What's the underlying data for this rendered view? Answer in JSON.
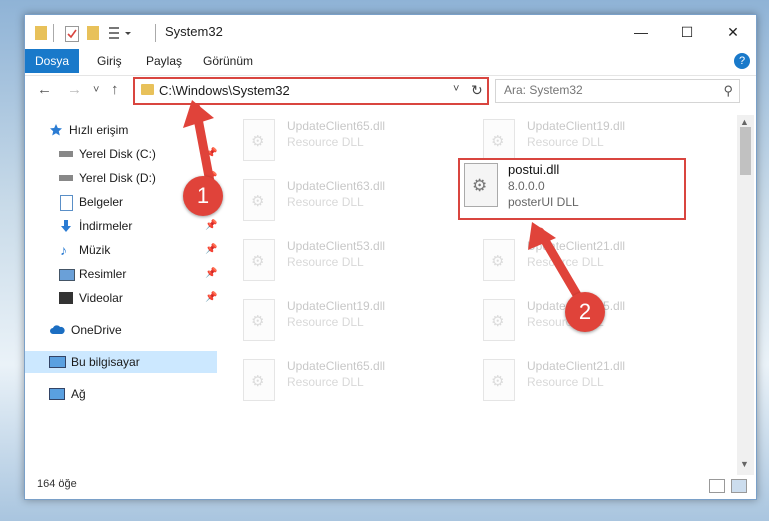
{
  "window": {
    "title": "System32",
    "minimize_glyph": "—",
    "maximize_glyph": "☐",
    "close_glyph": "✕"
  },
  "ribbon": {
    "tabs": [
      {
        "label": "Dosya"
      },
      {
        "label": "Giriş"
      },
      {
        "label": "Paylaş"
      },
      {
        "label": "Görünüm"
      }
    ],
    "help_glyph": "?"
  },
  "nav": {
    "back_glyph": "←",
    "forward_glyph": "→",
    "recent_glyph": "˅",
    "up_glyph": "↑"
  },
  "address": {
    "path": "C:\\Windows\\System32",
    "dropdown_glyph": "˅",
    "refresh_glyph": "↻"
  },
  "search": {
    "placeholder": "Ara: System32",
    "icon_glyph": "⚲"
  },
  "sidebar": {
    "items": [
      {
        "label": "Hızlı erişim"
      },
      {
        "label": "Yerel Disk (C:)"
      },
      {
        "label": "Yerel Disk (D:)"
      },
      {
        "label": "Belgeler"
      },
      {
        "label": "İndirmeler"
      },
      {
        "label": "Müzik"
      },
      {
        "label": "Resimler"
      },
      {
        "label": "Videolar"
      },
      {
        "label": "OneDrive"
      },
      {
        "label": "Bu bilgisayar"
      },
      {
        "label": "Ağ"
      }
    ]
  },
  "files": [
    {
      "name": "UpdateClient65.dll",
      "desc": "Resource DLL"
    },
    {
      "name": "UpdateClient19.dll",
      "desc": "Resource DLL"
    },
    {
      "name": "UpdateClient63.dll",
      "desc": "Resource DLL"
    },
    {
      "name": "UpdateClient53.dll",
      "desc": "Resource DLL"
    },
    {
      "name": "UpdateClient21.dll",
      "desc": "Resource DLL"
    },
    {
      "name": "UpdateClient19.dll",
      "desc": "Resource DLL"
    },
    {
      "name": "UpdateClient65.dll",
      "desc": "Resource DLL"
    },
    {
      "name": "UpdateClient65.dll",
      "desc": "Resource DLL"
    },
    {
      "name": "UpdateClient21.dll",
      "desc": "Resource DLL"
    }
  ],
  "highlighted_file": {
    "name": "postui.dll",
    "version": "8.0.0.0",
    "desc": "posterUI DLL"
  },
  "status": {
    "count_text": "164 öğe"
  },
  "annotations": {
    "step1": "1",
    "step2": "2",
    "color": "#e0433a"
  }
}
